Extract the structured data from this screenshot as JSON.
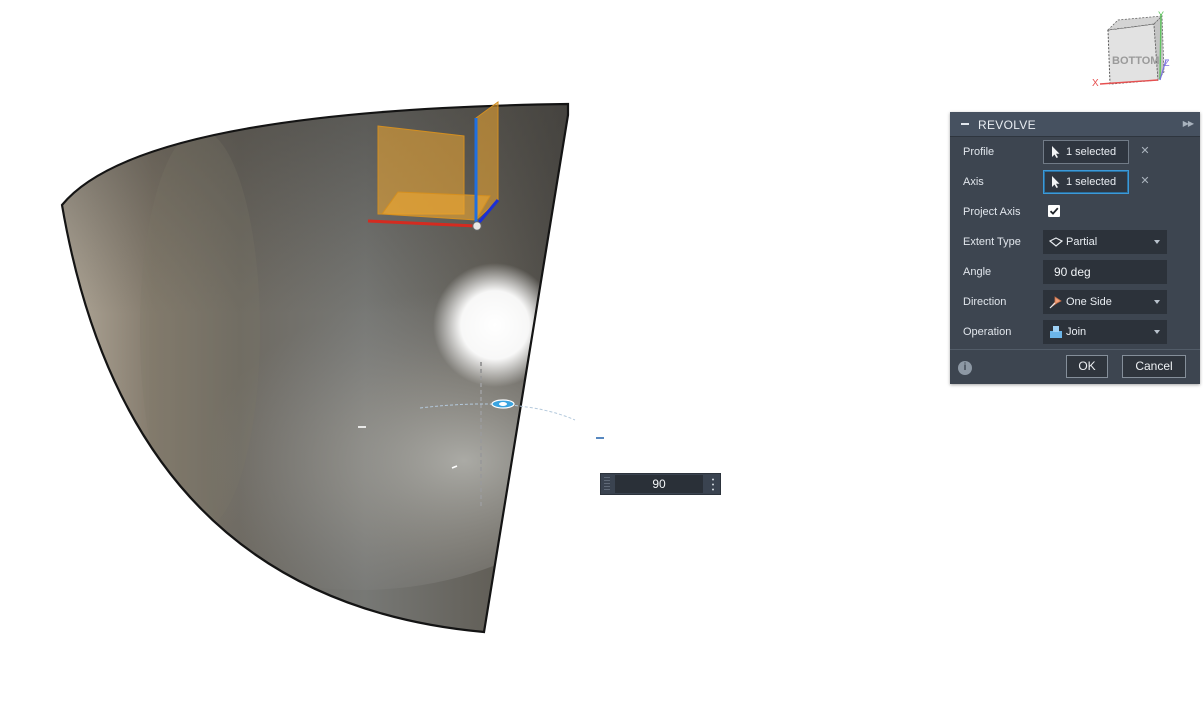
{
  "viewcube": {
    "face_label": "BOTTOM",
    "axis_x": "X",
    "axis_y": "Y",
    "axis_z": "Z"
  },
  "dialog": {
    "title": "REVOLVE",
    "rows": {
      "profile": {
        "label": "Profile",
        "value": "1 selected",
        "icon": "cursor-arrow-icon"
      },
      "axis": {
        "label": "Axis",
        "value": "1 selected",
        "icon": "cursor-arrow-icon"
      },
      "project_axis": {
        "label": "Project Axis",
        "checked": true
      },
      "extent_type": {
        "label": "Extent Type",
        "value": "Partial",
        "icon": "partial-extent-icon"
      },
      "angle": {
        "label": "Angle",
        "value": "90 deg"
      },
      "direction": {
        "label": "Direction",
        "value": "One Side",
        "icon": "one-side-direction-icon"
      },
      "operation": {
        "label": "Operation",
        "value": "Join",
        "icon": "join-operation-icon"
      }
    },
    "ok_label": "OK",
    "cancel_label": "Cancel",
    "info_glyph": "i"
  },
  "hud": {
    "angle_value": "90"
  },
  "colors": {
    "dialog_bg": "#3d4550",
    "active_border": "#3c9ad9",
    "sketch_plane": "#f0a830",
    "axis_red": "#d42b20",
    "axis_blue": "#1f6fe0"
  }
}
